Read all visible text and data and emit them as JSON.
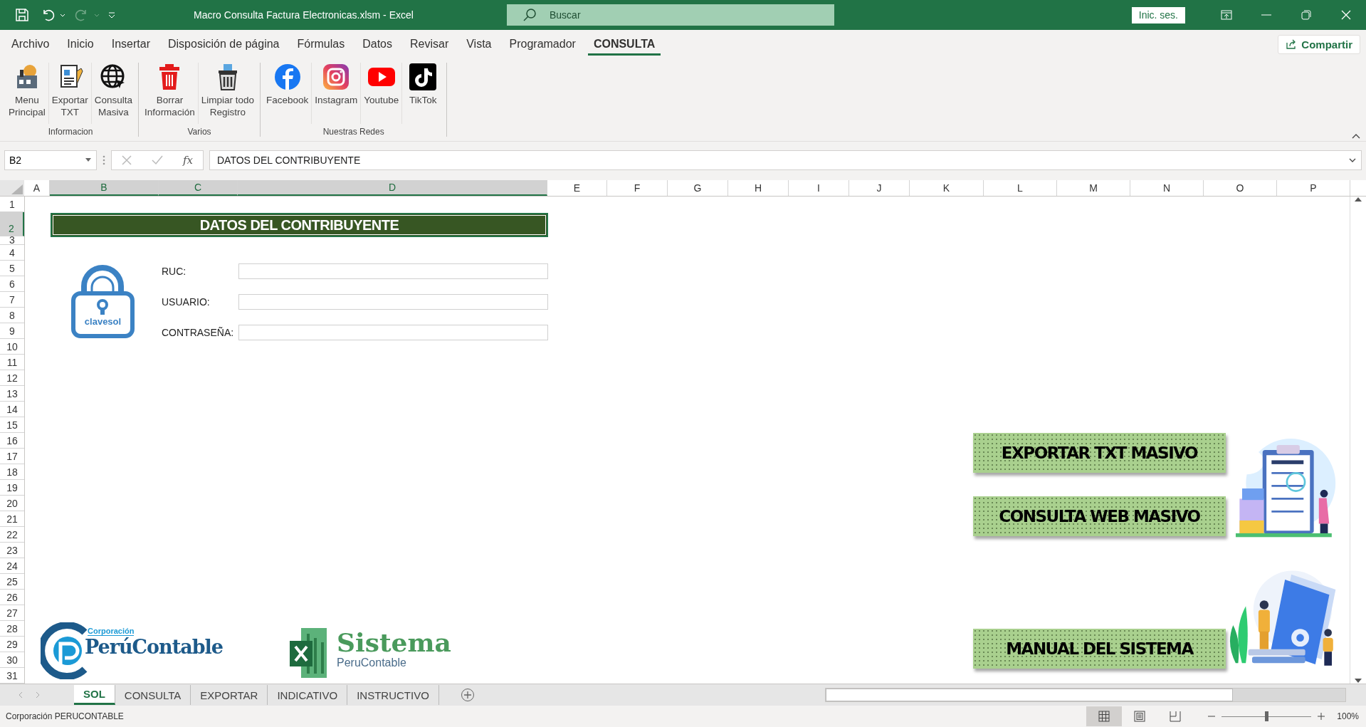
{
  "window": {
    "title": "Macro Consulta Factura Electronicas.xlsm  -  Excel",
    "search_placeholder": "Buscar",
    "sign_in": "Inic. ses."
  },
  "menu_tabs": [
    {
      "label": "Archivo",
      "selected": false
    },
    {
      "label": "Inicio",
      "selected": false
    },
    {
      "label": "Insertar",
      "selected": false
    },
    {
      "label": "Disposición de página",
      "selected": false
    },
    {
      "label": "Fórmulas",
      "selected": false
    },
    {
      "label": "Datos",
      "selected": false
    },
    {
      "label": "Revisar",
      "selected": false
    },
    {
      "label": "Vista",
      "selected": false
    },
    {
      "label": "Programador",
      "selected": false
    },
    {
      "label": "CONSULTA",
      "selected": true
    }
  ],
  "share_button": "Compartir",
  "ribbon_groups": [
    {
      "label": "Informacion",
      "buttons": [
        {
          "kind": "menu",
          "lines": [
            "Menu",
            "Principal"
          ]
        },
        {
          "kind": "export",
          "lines": [
            "Exportar",
            "TXT"
          ]
        },
        {
          "kind": "web",
          "lines": [
            "Consulta",
            "Masiva"
          ]
        }
      ]
    },
    {
      "label": "Varios",
      "buttons": [
        {
          "kind": "trash",
          "lines": [
            "Borrar",
            "Información"
          ]
        },
        {
          "kind": "clean",
          "lines": [
            "Limpiar todo",
            "Registro"
          ]
        }
      ]
    },
    {
      "label": "Nuestras Redes",
      "buttons": [
        {
          "kind": "facebook",
          "lines": [
            "Facebook"
          ]
        },
        {
          "kind": "instagram",
          "lines": [
            "Instagram"
          ]
        },
        {
          "kind": "youtube",
          "lines": [
            "Youtube"
          ]
        },
        {
          "kind": "tiktok",
          "lines": [
            "TikTok"
          ]
        }
      ]
    }
  ],
  "formula_bar": {
    "name_box": "B2",
    "function_label": "fx",
    "value": "DATOS DEL CONTRIBUYENTE"
  },
  "columns": [
    {
      "label": "A",
      "selected": false
    },
    {
      "label": "B",
      "selected": true
    },
    {
      "label": "C",
      "selected": true
    },
    {
      "label": "D",
      "selected": true
    },
    {
      "label": "E",
      "selected": false
    },
    {
      "label": "F",
      "selected": false
    },
    {
      "label": "G",
      "selected": false
    },
    {
      "label": "H",
      "selected": false
    },
    {
      "label": "I",
      "selected": false
    },
    {
      "label": "J",
      "selected": false
    },
    {
      "label": "K",
      "selected": false
    },
    {
      "label": "L",
      "selected": false
    },
    {
      "label": "M",
      "selected": false
    },
    {
      "label": "N",
      "selected": false
    },
    {
      "label": "O",
      "selected": false
    },
    {
      "label": "P",
      "selected": false
    }
  ],
  "rows": [
    {
      "label": "1",
      "selected": false
    },
    {
      "label": "2",
      "selected": true
    },
    {
      "label": "3",
      "selected": false
    },
    {
      "label": "4",
      "selected": false
    },
    {
      "label": "5",
      "selected": false
    },
    {
      "label": "6",
      "selected": false
    },
    {
      "label": "7",
      "selected": false
    },
    {
      "label": "8",
      "selected": false
    },
    {
      "label": "9",
      "selected": false
    },
    {
      "label": "10",
      "selected": false
    },
    {
      "label": "11",
      "selected": false
    },
    {
      "label": "12",
      "selected": false
    },
    {
      "label": "13",
      "selected": false
    },
    {
      "label": "14",
      "selected": false
    },
    {
      "label": "15",
      "selected": false
    },
    {
      "label": "16",
      "selected": false
    },
    {
      "label": "17",
      "selected": false
    },
    {
      "label": "18",
      "selected": false
    },
    {
      "label": "19",
      "selected": false
    },
    {
      "label": "20",
      "selected": false
    },
    {
      "label": "21",
      "selected": false
    },
    {
      "label": "22",
      "selected": false
    },
    {
      "label": "23",
      "selected": false
    },
    {
      "label": "24",
      "selected": false
    },
    {
      "label": "25",
      "selected": false
    },
    {
      "label": "26",
      "selected": false
    },
    {
      "label": "27",
      "selected": false
    },
    {
      "label": "28",
      "selected": false
    },
    {
      "label": "29",
      "selected": false
    },
    {
      "label": "30",
      "selected": false
    },
    {
      "label": "31",
      "selected": false
    }
  ],
  "sheet": {
    "header": "DATOS DEL CONTRIBUYENTE",
    "lock_caption": "clavesol",
    "fields": [
      {
        "label": "RUC:"
      },
      {
        "label": "USUARIO:"
      },
      {
        "label": "CONTRASEÑA:"
      }
    ],
    "action_buttons": [
      "EXPORTAR TXT MASIVO",
      "CONSULTA WEB MASIVO",
      "MANUAL DEL SISTEMA"
    ],
    "company_logo": {
      "tag": "Corporación",
      "name": "PerúContable"
    },
    "system_logo": {
      "title": "Sistema",
      "subtitle": "PeruContable"
    }
  },
  "sheet_tabs": [
    {
      "label": "SOL",
      "selected": true
    },
    {
      "label": "CONSULTA",
      "selected": false
    },
    {
      "label": "EXPORTAR",
      "selected": false
    },
    {
      "label": "INDICATIVO",
      "selected": false
    },
    {
      "label": "INSTRUCTIVO",
      "selected": false
    }
  ],
  "status_bar": {
    "text": "Corporación PERUCONTABLE",
    "views": [
      {
        "kind": "normal",
        "selected": true
      },
      {
        "kind": "page",
        "selected": false
      },
      {
        "kind": "break",
        "selected": false
      }
    ],
    "zoom": {
      "level": 0.5
    },
    "zoom_label": "100%"
  }
}
